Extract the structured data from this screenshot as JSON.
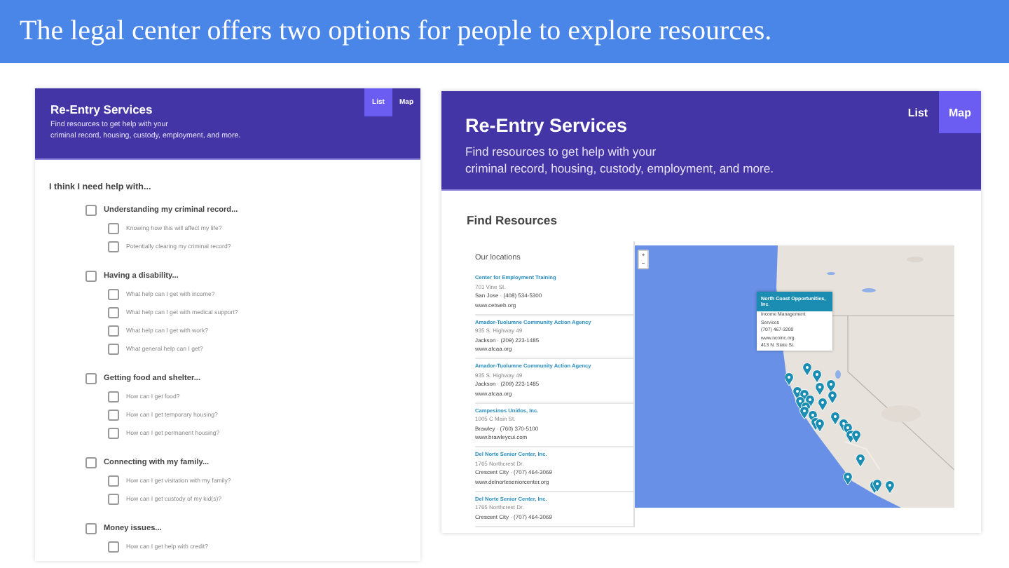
{
  "slide": {
    "title": "The legal center offers two options for people to explore resources."
  },
  "list_view": {
    "header": {
      "title": "Re-Entry Services",
      "subtitle_lines": [
        "Find resources to get help with your",
        "criminal record, housing, custody, employment, and more."
      ]
    },
    "tabs": [
      {
        "label": "List",
        "selected": true
      },
      {
        "label": "Map",
        "selected": false
      }
    ],
    "prompt": "I think I need help with...",
    "topics": [
      {
        "label": "Understanding my criminal record...",
        "checked": false,
        "children": [
          {
            "label": "Knowing how this will affect my life?",
            "checked": false
          },
          {
            "label": "Potentially clearing my criminal record?",
            "checked": false
          }
        ]
      },
      {
        "label": "Having a disability...",
        "checked": false,
        "children": [
          {
            "label": "What help can I get with income?",
            "checked": false
          },
          {
            "label": "What help can I get with medical support?",
            "checked": false
          },
          {
            "label": "What help can I get with work?",
            "checked": false
          },
          {
            "label": "What general help can I get?",
            "checked": false
          }
        ]
      },
      {
        "label": "Getting food and shelter...",
        "checked": false,
        "children": [
          {
            "label": "How can I get food?",
            "checked": false
          },
          {
            "label": "How can I get temporary housing?",
            "checked": false
          },
          {
            "label": "How can I get permanent housing?",
            "checked": false
          }
        ]
      },
      {
        "label": "Connecting with my family...",
        "checked": false,
        "children": [
          {
            "label": "How can I get visitation with my family?",
            "checked": false
          },
          {
            "label": "How can I get custody of my kid(s)?",
            "checked": false
          }
        ]
      },
      {
        "label": "Money issues...",
        "checked": false,
        "children": [
          {
            "label": "How can I get help with credit?",
            "checked": false
          }
        ]
      }
    ]
  },
  "map_view": {
    "header": {
      "title": "Re-Entry Services",
      "subtitle_lines": [
        "Find resources to get help with your",
        "criminal record, housing, custody, employment, and more."
      ]
    },
    "tabs": [
      {
        "label": "List",
        "selected": false
      },
      {
        "label": "Map",
        "selected": true
      }
    ],
    "section_title": "Find Resources",
    "locations_title": "Our locations",
    "locations": [
      {
        "name": "Center for Employment Training",
        "address": "701 Vine St.",
        "contact": "San Jose · (408) 534-5300",
        "website": "www.cetweb.org"
      },
      {
        "name": "Amador-Tuolumne Community Action Agency",
        "address": "935 S. Highway 49",
        "contact": "Jackson · (209) 223-1485",
        "website": "www.atcaa.org"
      },
      {
        "name": "Amador-Tuolumne Community Action Agency",
        "address": "935 S. Highway 49",
        "contact": "Jackson · (209) 223-1485",
        "website": "www.atcaa.org"
      },
      {
        "name": "Campesinos Unidos, Inc.",
        "address": "1005 C Main St.",
        "contact": "Brawley · (760) 370-5100",
        "website": "www.brawleycui.com"
      },
      {
        "name": "Del Norte Senior Center, Inc.",
        "address": "1765 Northcrest Dr.",
        "contact": "Crescent City · (707) 464-3069",
        "website": "www.delnorteseniorcenter.org"
      },
      {
        "name": "Del Norte Senior Center, Inc.",
        "address": "1765 Northcrest Dr.",
        "contact": "Crescent City · (707) 464-3069"
      }
    ],
    "zoom_controls": [
      "+",
      "−"
    ],
    "popup": {
      "title": "North Coast Opportunities, Inc.",
      "lines": [
        "Income Management",
        "Services",
        "(707) 467-3200",
        "www.ncoinc.org",
        "413 N. State St."
      ]
    }
  }
}
